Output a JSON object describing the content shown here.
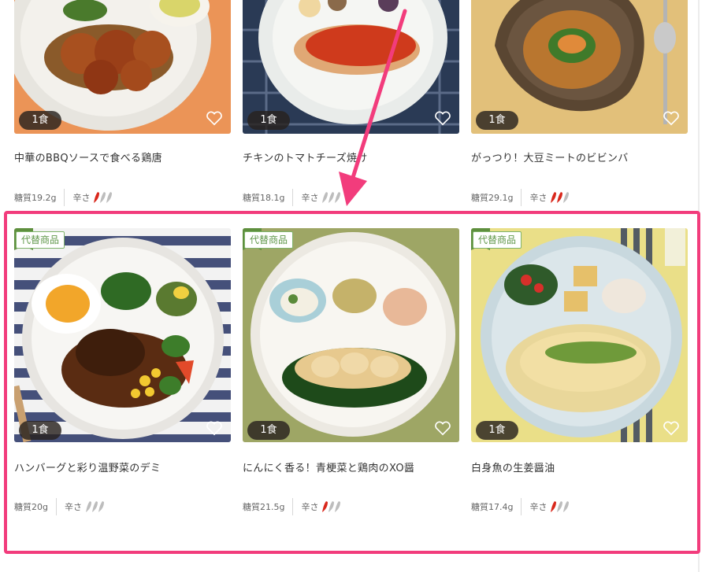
{
  "products_row1": [
    {
      "title": "中華のBBQソースで食べる鶏唐",
      "qty": "1食",
      "carb": "糖質19.2g",
      "spicy_label": "辛さ",
      "spicy_level": 1
    },
    {
      "title": "チキンのトマトチーズ焼け",
      "qty": "1食",
      "carb": "糖質18.1g",
      "spicy_label": "辛さ",
      "spicy_level": 0
    },
    {
      "title": "がっつり！大豆ミートのビビンバ",
      "qty": "1食",
      "carb": "糖質29.1g",
      "spicy_label": "辛さ",
      "spicy_level": 2
    }
  ],
  "products_row2": [
    {
      "title": "ハンバーグと彩り温野菜のデミ",
      "qty": "1食",
      "badge": "代替商品",
      "carb": "糖質20g",
      "spicy_label": "辛さ",
      "spicy_level": 0
    },
    {
      "title": "にんにく香る！青梗菜と鶏肉のXO醤",
      "qty": "1食",
      "badge": "代替商品",
      "carb": "糖質21.5g",
      "spicy_label": "辛さ",
      "spicy_level": 1
    },
    {
      "title": "白身魚の生姜醤油",
      "qty": "1食",
      "badge": "代替商品",
      "carb": "糖質17.4g",
      "spicy_label": "辛さ",
      "spicy_level": 1
    }
  ],
  "colors": {
    "highlight": "#f23c7c",
    "substitute_badge": "#5e9648",
    "chili_active": "#d9281c",
    "chili_inactive": "#bdbdbd"
  }
}
